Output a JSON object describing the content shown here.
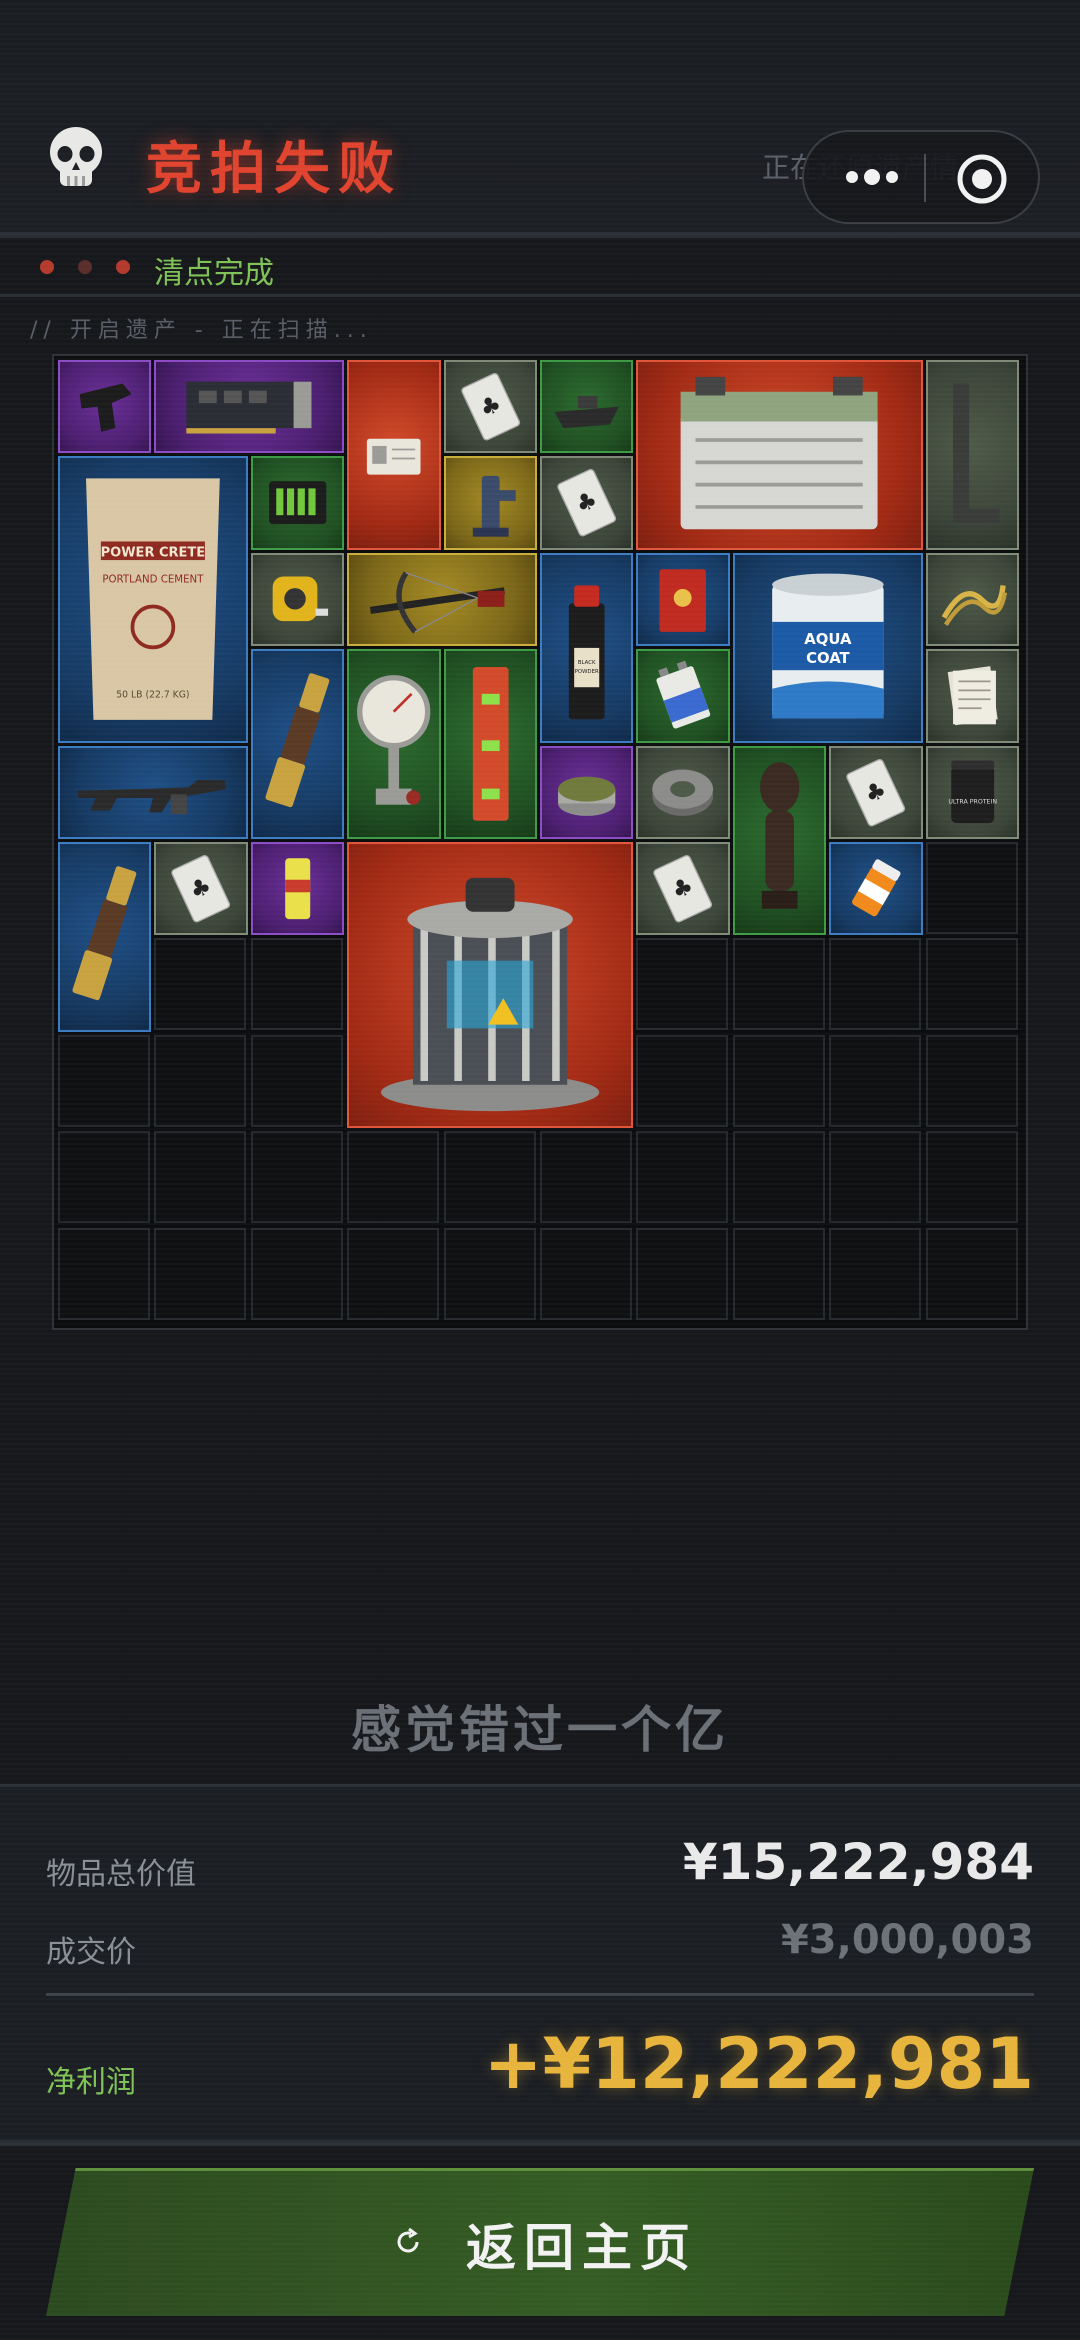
{
  "header": {
    "title": "竞拍失败",
    "subtitle_right": "正在还原遗产情...",
    "skull_icon": "skull-icon"
  },
  "capsule": {
    "more_icon": "more-dots-icon",
    "close_icon": "target-close-icon"
  },
  "status": {
    "label": "清点完成",
    "dot_colors": [
      "#b33a2c",
      "#5a2e2a",
      "#b33a2c"
    ]
  },
  "scan_line": "//  开启遗产  -  正在扫描...",
  "colors": {
    "title_red": "#e0432e",
    "status_green": "#7fc256",
    "profit_gold": "#e7b43c",
    "button_green": "#355c24"
  },
  "inventory": {
    "columns": 10,
    "rows": 10,
    "items": [
      {
        "name": "tactical-grip",
        "rarity": "purple",
        "icon": "tactical-grip-icon"
      },
      {
        "name": "graphics-card",
        "rarity": "purple",
        "icon": "graphics-card-icon"
      },
      {
        "name": "id-card",
        "rarity": "red",
        "icon": "id-card-icon"
      },
      {
        "name": "playing-card",
        "rarity": "gray",
        "icon": "playing-card-icon"
      },
      {
        "name": "toy-boat",
        "rarity": "green",
        "icon": "boat-icon"
      },
      {
        "name": "car-battery",
        "rarity": "red",
        "icon": "battery-icon"
      },
      {
        "name": "metal-bracket",
        "rarity": "gray",
        "icon": "bracket-icon"
      },
      {
        "name": "cement-bag",
        "rarity": "blue",
        "icon": "cement-bag-icon",
        "text": "POWER CRETE",
        "sub": "PORTLAND CEMENT",
        "weight": "50 LB (22.7 KG)"
      },
      {
        "name": "battery-charger",
        "rarity": "green",
        "icon": "charger-icon"
      },
      {
        "name": "faucet",
        "rarity": "yellow",
        "icon": "faucet-icon"
      },
      {
        "name": "playing-card",
        "rarity": "gray",
        "icon": "playing-card-icon"
      },
      {
        "name": "tape-measure",
        "rarity": "gray",
        "icon": "tape-measure-icon"
      },
      {
        "name": "crossbow",
        "rarity": "yellow",
        "icon": "crossbow-icon"
      },
      {
        "name": "black-powder",
        "rarity": "blue",
        "icon": "bottle-icon",
        "text": "BLACK POWDER"
      },
      {
        "name": "tea-tin",
        "rarity": "blue",
        "icon": "tin-icon"
      },
      {
        "name": "paint-bucket",
        "rarity": "blue",
        "icon": "paint-bucket-icon",
        "text": "AQUA COAT"
      },
      {
        "name": "rope",
        "rarity": "gray",
        "icon": "rope-icon"
      },
      {
        "name": "spyglass",
        "rarity": "blue",
        "icon": "spyglass-icon"
      },
      {
        "name": "pressure-gauge",
        "rarity": "green",
        "icon": "gauge-icon"
      },
      {
        "name": "level-tool",
        "rarity": "green",
        "icon": "level-icon"
      },
      {
        "name": "battery-9v",
        "rarity": "green",
        "icon": "battery-9v-icon"
      },
      {
        "name": "receipts",
        "rarity": "gray",
        "icon": "paper-icon"
      },
      {
        "name": "rifle",
        "rarity": "blue",
        "icon": "rifle-icon"
      },
      {
        "name": "food-can",
        "rarity": "purple",
        "icon": "can-icon"
      },
      {
        "name": "duct-tape",
        "rarity": "gray",
        "icon": "tape-roll-icon"
      },
      {
        "name": "statue",
        "rarity": "green",
        "icon": "statue-icon"
      },
      {
        "name": "playing-card",
        "rarity": "gray",
        "icon": "playing-card-icon"
      },
      {
        "name": "protein-jar",
        "rarity": "gray",
        "icon": "jar-icon",
        "text": "ULTRA PROTEIN"
      },
      {
        "name": "spyglass",
        "rarity": "blue",
        "icon": "spyglass-icon"
      },
      {
        "name": "playing-card",
        "rarity": "gray",
        "icon": "playing-card-icon"
      },
      {
        "name": "energy-drink",
        "rarity": "purple",
        "icon": "drink-can-icon"
      },
      {
        "name": "reactor-core",
        "rarity": "red",
        "icon": "reactor-icon"
      },
      {
        "name": "playing-card",
        "rarity": "gray",
        "icon": "playing-card-icon"
      },
      {
        "name": "pill-bottle",
        "rarity": "blue",
        "icon": "pill-bottle-icon"
      }
    ]
  },
  "tagline": "感觉错过一个亿",
  "summary": {
    "total_label": "物品总价值",
    "total_value": "¥15,222,984",
    "deal_label": "成交价",
    "deal_value": "¥3,000,003",
    "profit_label": "净利润",
    "profit_value": "+¥12,222,981"
  },
  "button": {
    "label": "返回主页",
    "icon": "refresh-icon"
  }
}
